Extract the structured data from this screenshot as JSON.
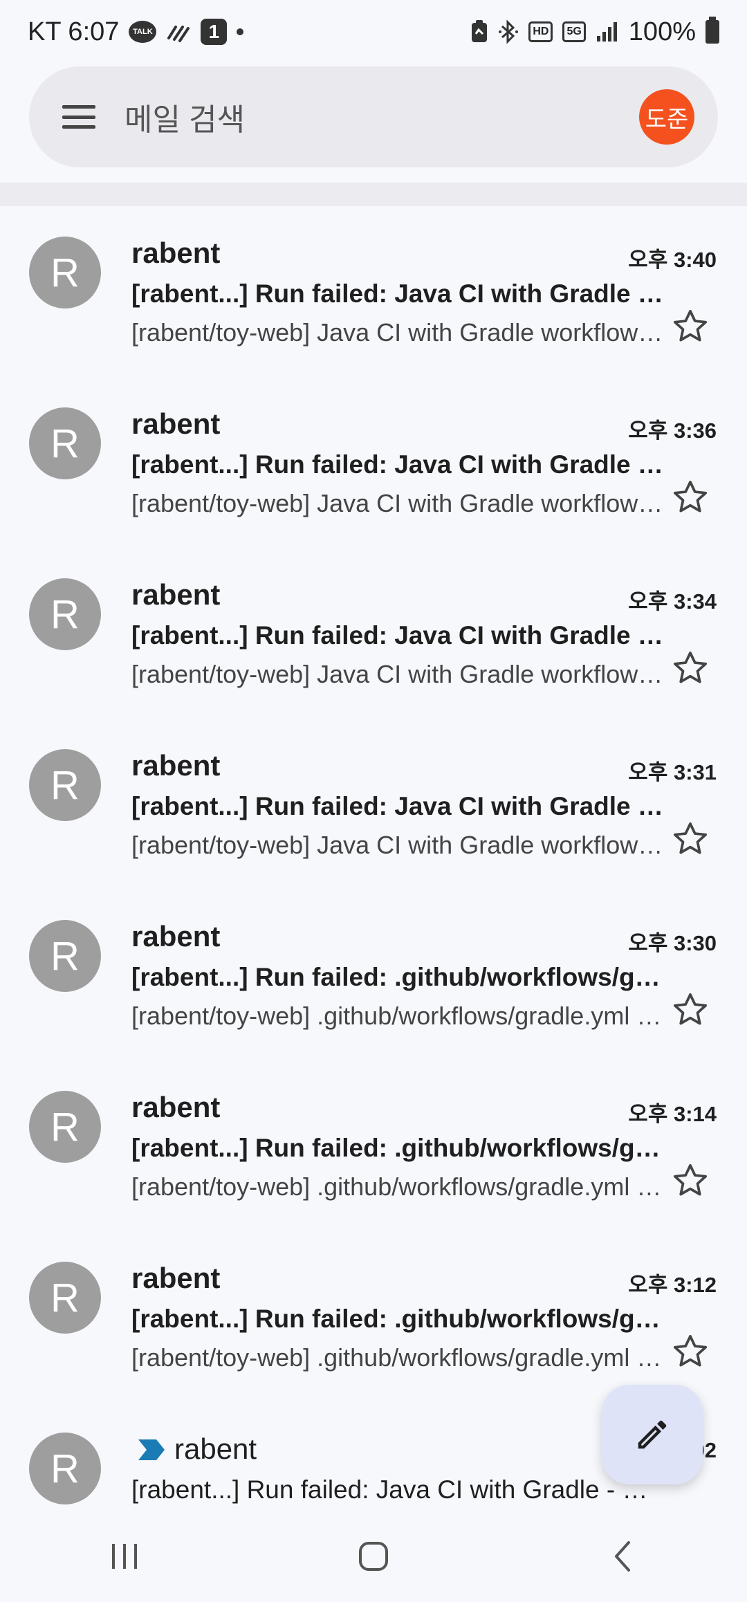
{
  "status_bar": {
    "carrier_time": "KT 6:07",
    "talk_label": "TALK",
    "notification_count": "1",
    "hd_label": "HD",
    "network_label": "5G",
    "battery_percent": "100%"
  },
  "search": {
    "placeholder": "메일 검색",
    "account_initials": "도준",
    "account_color": "#f4511e"
  },
  "emails": [
    {
      "avatar": "R",
      "sender": "rabent",
      "time": "오후 3:40",
      "subject": "[rabent...] Run failed: Java CI with Gradle - master (...",
      "snippet": "[rabent/toy-web] Java CI with Gradle workflow run",
      "starred": false
    },
    {
      "avatar": "R",
      "sender": "rabent",
      "time": "오후 3:36",
      "subject": "[rabent...] Run failed: Java CI with Gradle - master (...",
      "snippet": "[rabent/toy-web] Java CI with Gradle workflow run",
      "starred": false
    },
    {
      "avatar": "R",
      "sender": "rabent",
      "time": "오후 3:34",
      "subject": "[rabent...] Run failed: Java CI with Gradle - master (...",
      "snippet": "[rabent/toy-web] Java CI with Gradle workflow run",
      "starred": false
    },
    {
      "avatar": "R",
      "sender": "rabent",
      "time": "오후 3:31",
      "subject": "[rabent...] Run failed: Java CI with Gradle - master (...",
      "snippet": "[rabent/toy-web] Java CI with Gradle workflow run",
      "starred": false
    },
    {
      "avatar": "R",
      "sender": "rabent",
      "time": "오후 3:30",
      "subject": "[rabent...] Run failed: .github/workflows/gradle.yml",
      "snippet": "[rabent/toy-web] .github/workflows/gradle.yml workflow run",
      "starred": false
    },
    {
      "avatar": "R",
      "sender": "rabent",
      "time": "오후 3:14",
      "subject": "[rabent...] Run failed: .github/workflows/gradle.yml",
      "snippet": "[rabent/toy-web] .github/workflows/gradle.yml workflow run",
      "starred": false
    },
    {
      "avatar": "R",
      "sender": "rabent",
      "time": "오후 3:12",
      "subject": "[rabent...] Run failed: .github/workflows/gradle.yml",
      "snippet": "[rabent/toy-web] .github/workflows/gradle.yml workflow run",
      "starred": false
    },
    {
      "avatar": "R",
      "sender": "rabent",
      "time": "02",
      "subject": "[rabent...] Run failed: Java CI with Gradle - master",
      "snippet": "",
      "starred": false,
      "important": true
    }
  ],
  "colors": {
    "avatar_gray": "#9e9e9e",
    "important_marker": "#1a7bb5",
    "fab_bg": "#dfe3f8"
  },
  "icons": {
    "menu": "hamburger-menu-icon",
    "star": "star-outline-icon",
    "compose": "pencil-icon",
    "nav_recent": "recent-apps-icon",
    "nav_home": "home-icon",
    "nav_back": "back-icon"
  }
}
